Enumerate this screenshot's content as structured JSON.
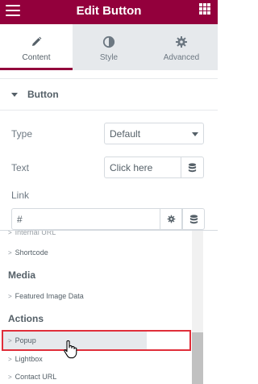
{
  "header": {
    "title": "Edit Button",
    "menu_icon": "hamburger-menu-icon",
    "apps_icon": "grid-apps-icon",
    "brand_color": "#93003c"
  },
  "tabs": [
    {
      "label": "Content",
      "icon": "pencil-icon",
      "active": true
    },
    {
      "label": "Style",
      "icon": "half-circle-icon",
      "active": false
    },
    {
      "label": "Advanced",
      "icon": "gear-icon",
      "active": false
    }
  ],
  "section": {
    "title": "Button",
    "expanded": true
  },
  "controls": {
    "type_label": "Type",
    "type_value": "Default",
    "text_label": "Text",
    "text_value": "Click here",
    "link_label": "Link",
    "link_value": "#"
  },
  "dynamic_tags": {
    "cut_item": "Internal URL",
    "items_top": [
      {
        "label": "Shortcode"
      }
    ],
    "groups": [
      {
        "title": "Media",
        "items": [
          "Featured Image Data"
        ]
      },
      {
        "title": "Actions",
        "items": [
          "Popup",
          "Lightbox",
          "Contact URL"
        ]
      }
    ],
    "selected": "Popup",
    "highlight_color": "#e02e3a"
  }
}
